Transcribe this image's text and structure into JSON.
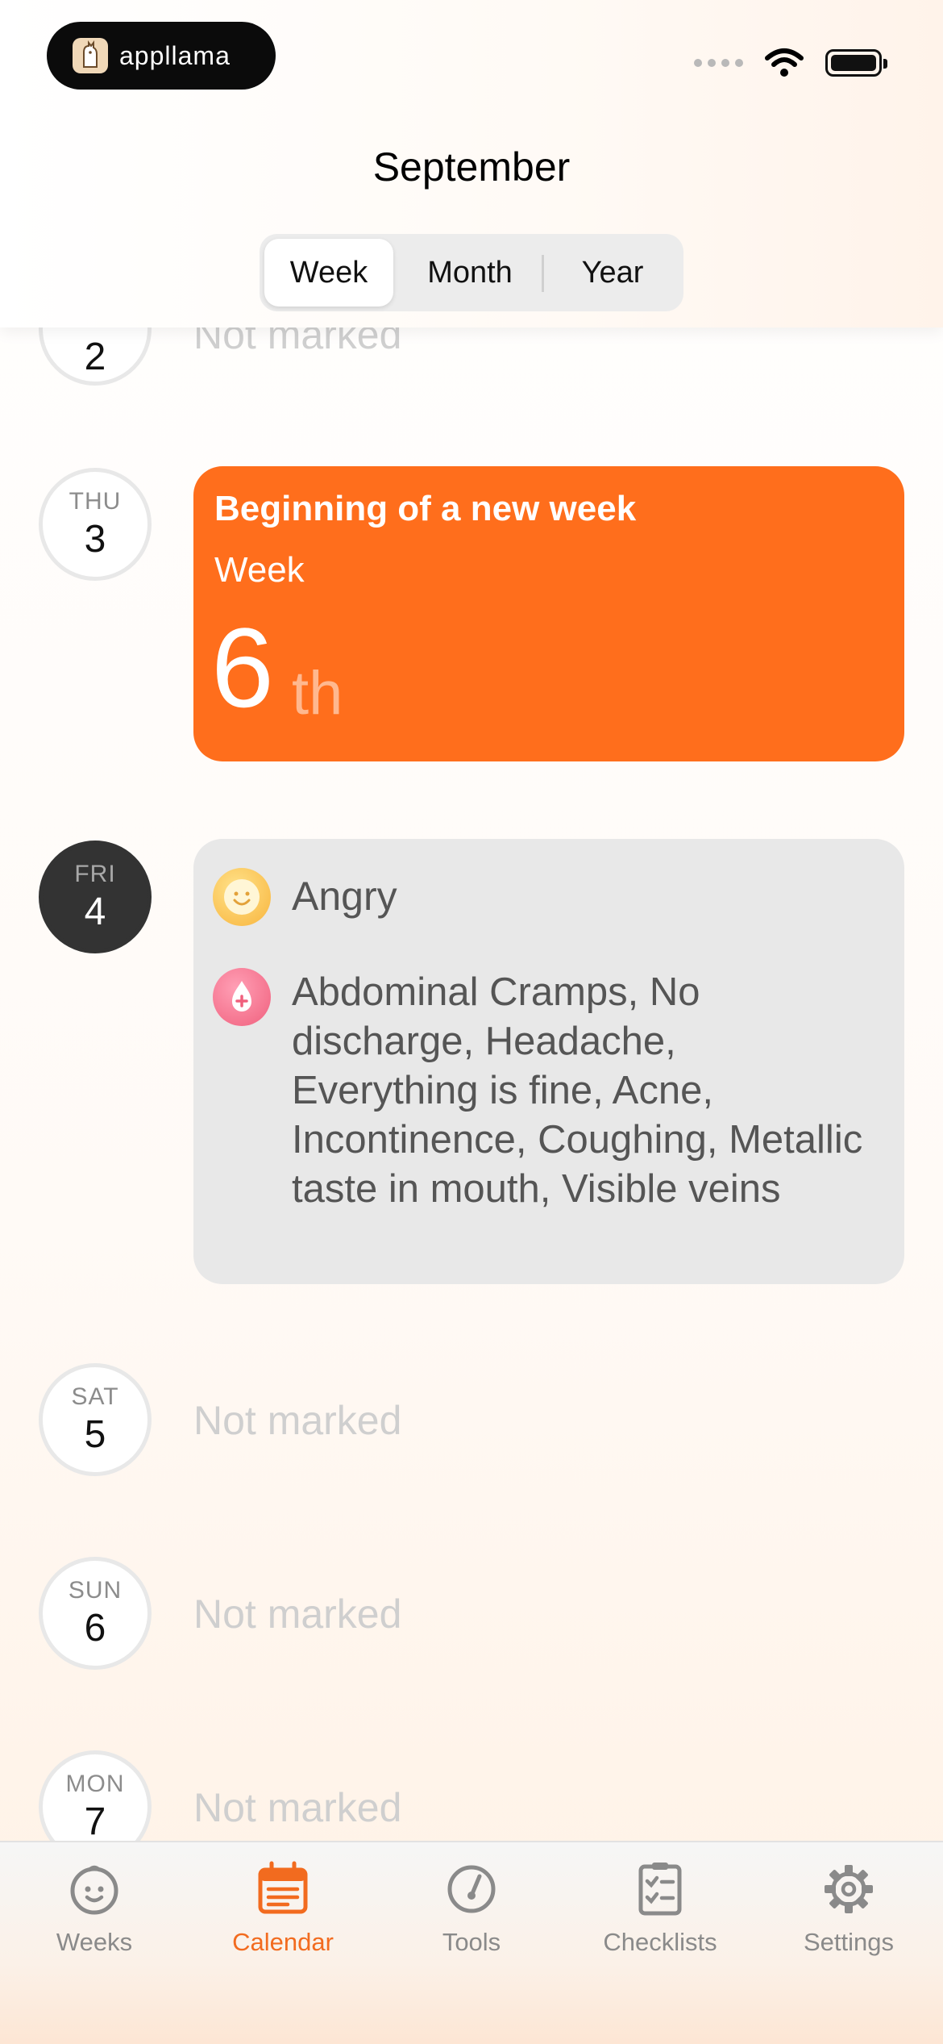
{
  "app_badge": {
    "name": "appllama"
  },
  "header": {
    "month": "September",
    "segments": [
      "Week",
      "Month",
      "Year"
    ],
    "active_segment": "Week"
  },
  "days": [
    {
      "dow": "",
      "num": "2",
      "status": "Not marked"
    },
    {
      "dow": "THU",
      "num": "3"
    },
    {
      "dow": "FRI",
      "num": "4",
      "selected": true
    },
    {
      "dow": "SAT",
      "num": "5",
      "status": "Not marked"
    },
    {
      "dow": "SUN",
      "num": "6",
      "status": "Not marked"
    },
    {
      "dow": "MON",
      "num": "7",
      "status": "Not marked"
    }
  ],
  "week_card": {
    "title": "Beginning of a new week",
    "label": "Week",
    "number": "6",
    "suffix": "th",
    "color": "#ff6e1c"
  },
  "log_card": {
    "mood": "Angry",
    "symptoms": "Abdominal Cramps, No discharge, Headache, Everything is fine, Acne, Incontinence, Coughing, Metallic taste in mouth, Visible veins"
  },
  "tabbar": {
    "tabs": [
      {
        "label": "Weeks",
        "icon": "baby-face-icon"
      },
      {
        "label": "Calendar",
        "icon": "calendar-icon",
        "active": true
      },
      {
        "label": "Tools",
        "icon": "gauge-icon"
      },
      {
        "label": "Checklists",
        "icon": "checklist-icon"
      },
      {
        "label": "Settings",
        "icon": "gear-icon"
      }
    ],
    "accent": "#f26b1f"
  }
}
